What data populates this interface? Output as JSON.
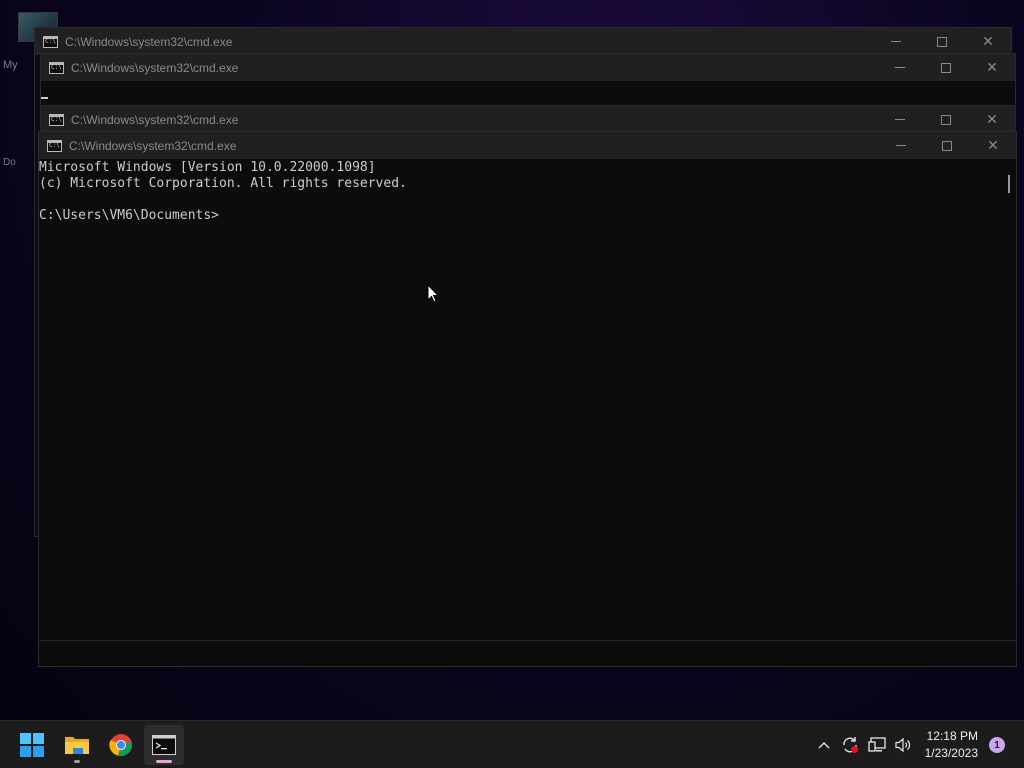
{
  "desktop": {
    "icon_label_1": "My",
    "icon_label_2": "Do"
  },
  "windows": [
    {
      "title": "C:\\Windows\\system32\\cmd.exe"
    },
    {
      "title": "C:\\Windows\\system32\\cmd.exe"
    },
    {
      "title": "C:\\Windows\\system32\\cmd.exe"
    },
    {
      "title": "C:\\Windows\\system32\\cmd.exe"
    }
  ],
  "console": {
    "line1": "Microsoft Windows [Version 10.0.22000.1098]",
    "line2": "(c) Microsoft Corporation. All rights reserved.",
    "line3": "",
    "prompt": "C:\\Users\\VM6\\Documents>"
  },
  "window_buttons": {
    "minimize": "minimize",
    "maximize": "maximize",
    "close": "✕"
  },
  "taskbar": {
    "apps": [
      {
        "name": "start-button",
        "icon": "windows-logo-icon"
      },
      {
        "name": "file-explorer",
        "icon": "folder-icon"
      },
      {
        "name": "chrome",
        "icon": "chrome-icon"
      },
      {
        "name": "command-prompt",
        "icon": "cmd-icon"
      }
    ],
    "tray": {
      "chevron": "^",
      "time": "12:18 PM",
      "date": "1/23/2023",
      "notification_count": "1"
    }
  },
  "colors": {
    "accent_blue": "#0078d4",
    "indicator_pink": "#e6a5d8",
    "console_bg": "#0c0c0c",
    "console_text": "#cccccc"
  }
}
